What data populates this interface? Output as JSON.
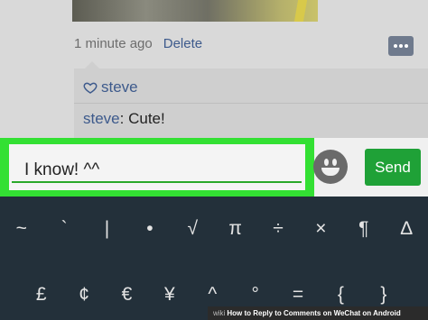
{
  "moment": {
    "timestamp": "1 minute ago",
    "delete_label": "Delete",
    "like_user": "steve",
    "comment_author": "steve",
    "comment_text": ": Cute!"
  },
  "composer": {
    "input_value": "I know! ^^",
    "send_label": "Send",
    "accent_color": "#33e033",
    "send_color": "#1fa137"
  },
  "keyboard": {
    "row1": [
      "~",
      "`",
      "|",
      "•",
      "√",
      "π",
      "÷",
      "×",
      "¶",
      "∆"
    ],
    "row2": [
      "£",
      "¢",
      "€",
      "¥",
      "^",
      "°",
      "=",
      "{",
      "}"
    ]
  },
  "caption": {
    "brand": "wiki",
    "text": "How to Reply to Comments on WeChat on Android"
  }
}
